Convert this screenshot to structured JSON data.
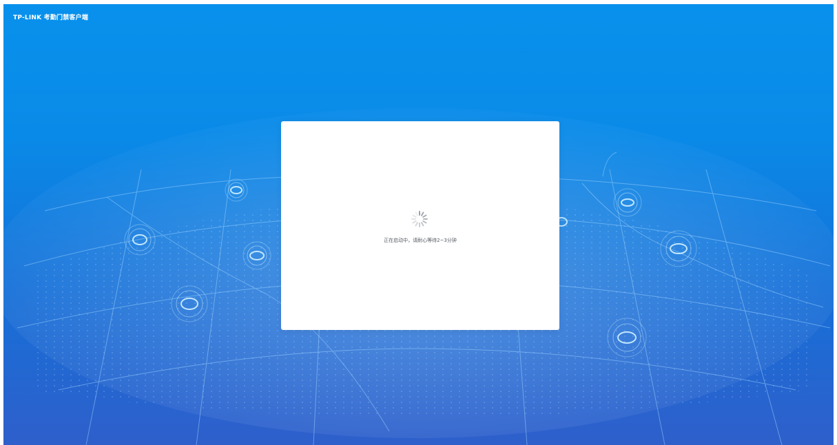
{
  "header": {
    "brand_text": "TP-LINK 考勤门禁客户端"
  },
  "loading_dialog": {
    "status_text": "正在启动中，请耐心等待2~3分钟",
    "spinner_icon": "loading-spinner-icon"
  },
  "colors": {
    "background_top": "#0891ec",
    "background_bottom": "#2f5fcb",
    "dialog_background": "#ffffff",
    "status_text": "#555a60",
    "map_lines": "#9fd4ff"
  }
}
